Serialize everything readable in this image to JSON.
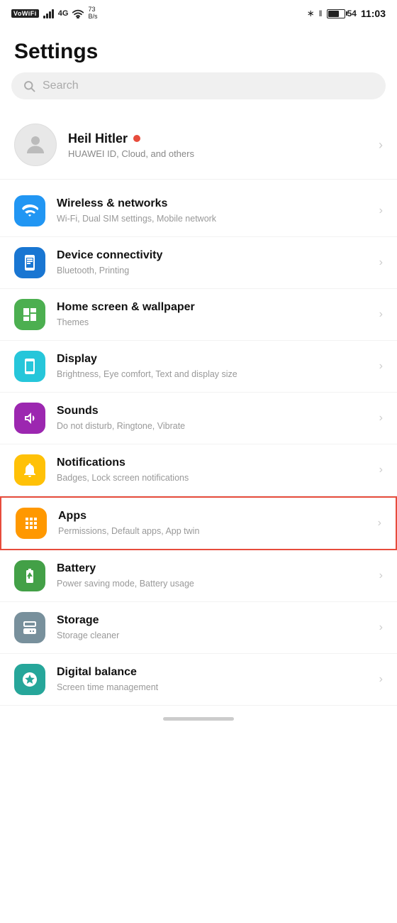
{
  "statusBar": {
    "left": {
      "vowifi": "VoWiFi",
      "signal": "4G",
      "speed": "73\nB/s"
    },
    "right": {
      "battery": "54",
      "time": "11:03"
    }
  },
  "header": {
    "title": "Settings"
  },
  "search": {
    "placeholder": "Search"
  },
  "profile": {
    "name": "Heil Hitler",
    "nameDot": "●",
    "subtitle": "HUAWEI ID, Cloud, and others"
  },
  "settingsItems": [
    {
      "id": "wireless",
      "title": "Wireless & networks",
      "subtitle": "Wi-Fi, Dual SIM settings, Mobile network",
      "iconColor": "blue",
      "iconType": "wifi"
    },
    {
      "id": "device-connectivity",
      "title": "Device connectivity",
      "subtitle": "Bluetooth, Printing",
      "iconColor": "blue2",
      "iconType": "device"
    },
    {
      "id": "home-screen",
      "title": "Home screen & wallpaper",
      "subtitle": "Themes",
      "iconColor": "green-light",
      "iconType": "home"
    },
    {
      "id": "display",
      "title": "Display",
      "subtitle": "Brightness, Eye comfort, Text and display size",
      "iconColor": "teal",
      "iconType": "display"
    },
    {
      "id": "sounds",
      "title": "Sounds",
      "subtitle": "Do not disturb, Ringtone, Vibrate",
      "iconColor": "purple",
      "iconType": "sound"
    },
    {
      "id": "notifications",
      "title": "Notifications",
      "subtitle": "Badges, Lock screen notifications",
      "iconColor": "amber",
      "iconType": "bell"
    },
    {
      "id": "apps",
      "title": "Apps",
      "subtitle": "Permissions, Default apps, App twin",
      "iconColor": "orange",
      "iconType": "apps",
      "highlighted": true
    },
    {
      "id": "battery",
      "title": "Battery",
      "subtitle": "Power saving mode, Battery usage",
      "iconColor": "green",
      "iconType": "battery"
    },
    {
      "id": "storage",
      "title": "Storage",
      "subtitle": "Storage cleaner",
      "iconColor": "grey",
      "iconType": "storage"
    },
    {
      "id": "digital-balance",
      "title": "Digital balance",
      "subtitle": "Screen time management",
      "iconColor": "teal2",
      "iconType": "balance"
    }
  ]
}
